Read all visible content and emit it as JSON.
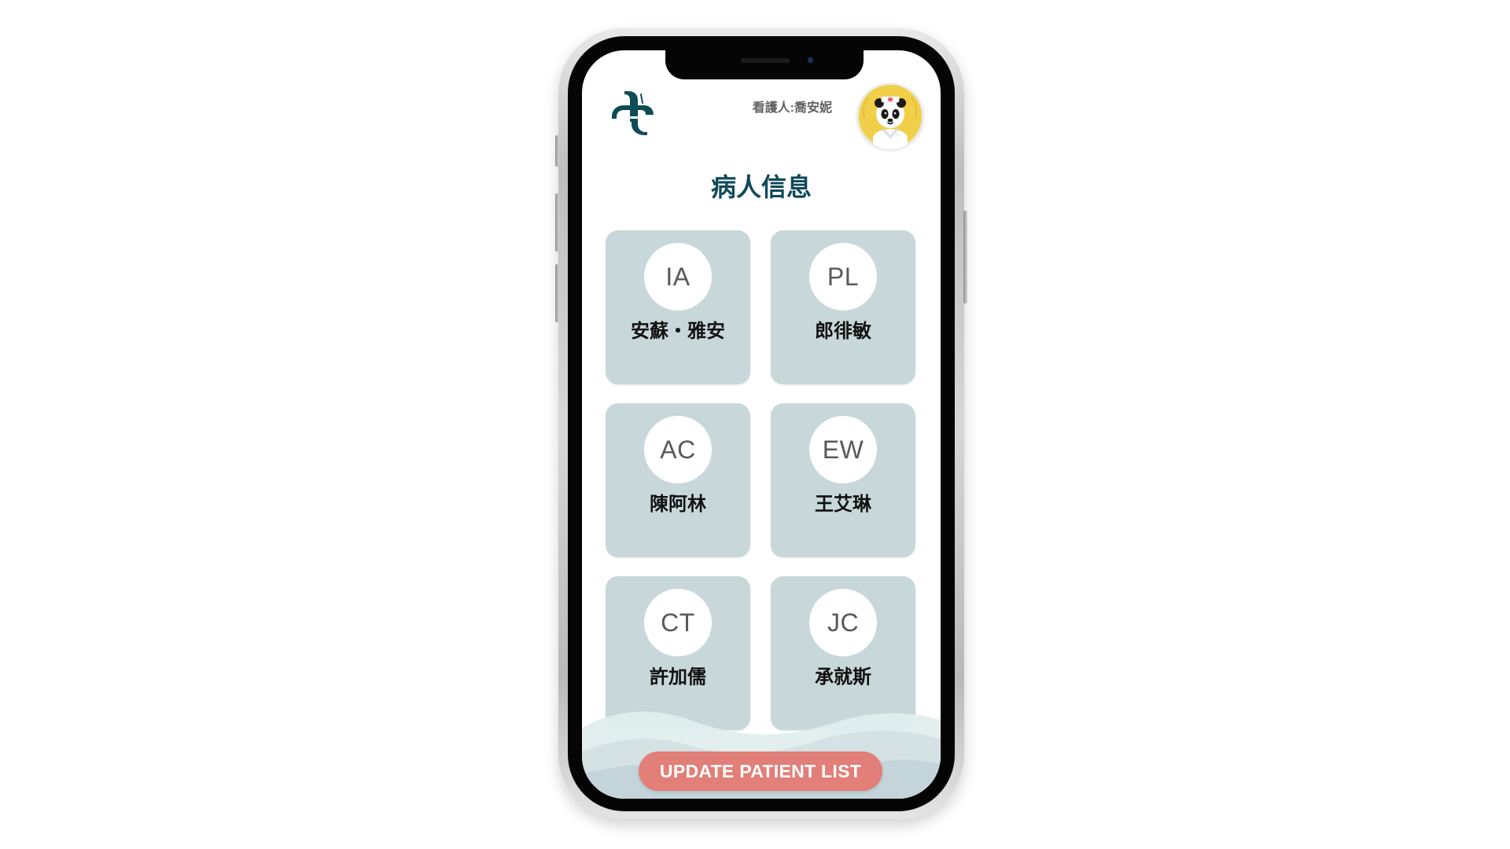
{
  "header": {
    "caregiver_label": "看護人:喬安妮",
    "logo_icon": "medical-cross-logo-icon",
    "avatar_icon": "panda-nurse-avatar-icon"
  },
  "page": {
    "title": "病人信息"
  },
  "patients": [
    {
      "initials": "IA",
      "name": "安蘇・雅安"
    },
    {
      "initials": "PL",
      "name": "郎徘敏"
    },
    {
      "initials": "AC",
      "name": "陳阿林"
    },
    {
      "initials": "EW",
      "name": "王艾琳"
    },
    {
      "initials": "CT",
      "name": "許加儒"
    },
    {
      "initials": "JC",
      "name": "承就斯"
    }
  ],
  "actions": {
    "update_patient_list": "UPDATE PATIENT LIST"
  },
  "colors": {
    "primary_text": "#11495a",
    "card_background": "#c8d8da",
    "button_background": "#e27f78",
    "avatar_background": "#f2cf48"
  }
}
